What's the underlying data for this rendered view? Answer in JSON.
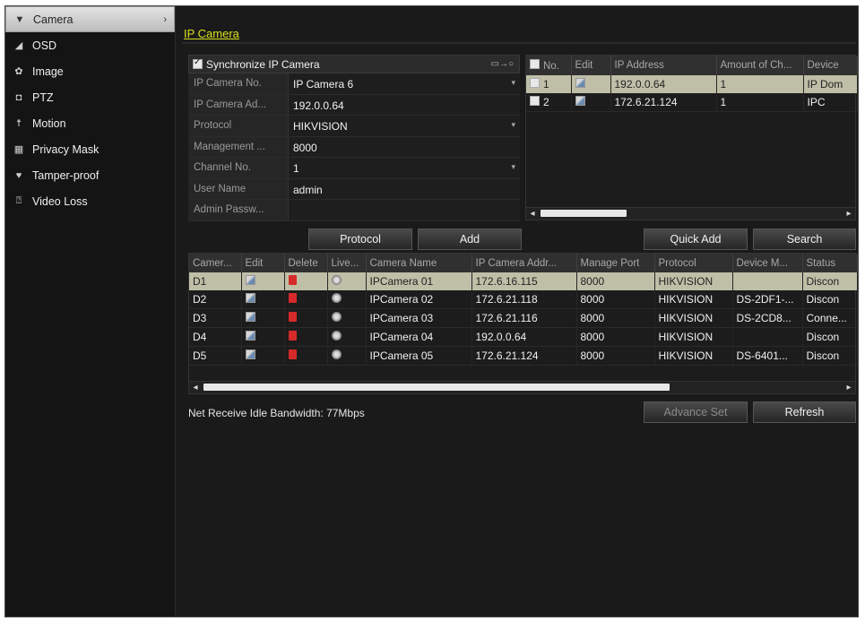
{
  "sidebar": {
    "items": [
      {
        "label": "Camera",
        "icon": "camera-icon",
        "active": true
      },
      {
        "label": "OSD",
        "icon": "osd-icon"
      },
      {
        "label": "Image",
        "icon": "image-icon"
      },
      {
        "label": "PTZ",
        "icon": "ptz-icon"
      },
      {
        "label": "Motion",
        "icon": "motion-icon"
      },
      {
        "label": "Privacy Mask",
        "icon": "privacy-mask-icon"
      },
      {
        "label": "Tamper-proof",
        "icon": "tamper-proof-icon"
      },
      {
        "label": "Video Loss",
        "icon": "video-loss-icon"
      }
    ]
  },
  "header": {
    "tab": "IP Camera"
  },
  "form": {
    "sync_label": "Synchronize IP Camera",
    "sync_checked": true,
    "fields": [
      {
        "label": "IP Camera No.",
        "value": "IP Camera 6",
        "dropdown": true
      },
      {
        "label": "IP Camera Ad...",
        "value": "192.0.0.64"
      },
      {
        "label": "Protocol",
        "value": "HIKVISION",
        "dropdown": true
      },
      {
        "label": "Management ...",
        "value": "8000"
      },
      {
        "label": "Channel No.",
        "value": "1",
        "dropdown": true
      },
      {
        "label": "User Name",
        "value": "admin"
      },
      {
        "label": "Admin Passw...",
        "value": ""
      }
    ]
  },
  "top_table": {
    "headers": [
      "No.",
      "Edit",
      "IP Address",
      "Amount of Ch...",
      "Device"
    ],
    "rows": [
      {
        "no": "1",
        "ip": "192.0.0.64",
        "amount": "1",
        "device": "IP Dom"
      },
      {
        "no": "2",
        "ip": "172.6.21.124",
        "amount": "1",
        "device": "IPC"
      }
    ]
  },
  "buttons": {
    "protocol": "Protocol",
    "add": "Add",
    "quick_add": "Quick Add",
    "search": "Search",
    "advance_set": "Advance Set",
    "refresh": "Refresh"
  },
  "bottom_table": {
    "headers": [
      "Camer...",
      "Edit",
      "Delete",
      "Live...",
      "Camera Name",
      "IP Camera Addr...",
      "Manage Port",
      "Protocol",
      "Device M...",
      "Status"
    ],
    "rows": [
      {
        "cam": "D1",
        "name": "IPCamera 01",
        "ip": "172.6.16.115",
        "port": "8000",
        "protocol": "HIKVISION",
        "model": "",
        "status": "Discon"
      },
      {
        "cam": "D2",
        "name": "IPCamera 02",
        "ip": "172.6.21.118",
        "port": "8000",
        "protocol": "HIKVISION",
        "model": "DS-2DF1-...",
        "status": "Discon"
      },
      {
        "cam": "D3",
        "name": "IPCamera 03",
        "ip": "172.6.21.116",
        "port": "8000",
        "protocol": "HIKVISION",
        "model": "DS-2CD8...",
        "status": "Conne..."
      },
      {
        "cam": "D4",
        "name": "IPCamera 04",
        "ip": "192.0.0.64",
        "port": "8000",
        "protocol": "HIKVISION",
        "model": "",
        "status": "Discon"
      },
      {
        "cam": "D5",
        "name": "IPCamera 05",
        "ip": "172.6.21.124",
        "port": "8000",
        "protocol": "HIKVISION",
        "model": "DS-6401...",
        "status": "Discon"
      }
    ]
  },
  "bandwidth": "Net Receive Idle Bandwidth: 77Mbps",
  "colors": {
    "accent": "#d8e01a",
    "selected_row": "#bfbfa8",
    "delete_icon": "#d62a2a"
  }
}
